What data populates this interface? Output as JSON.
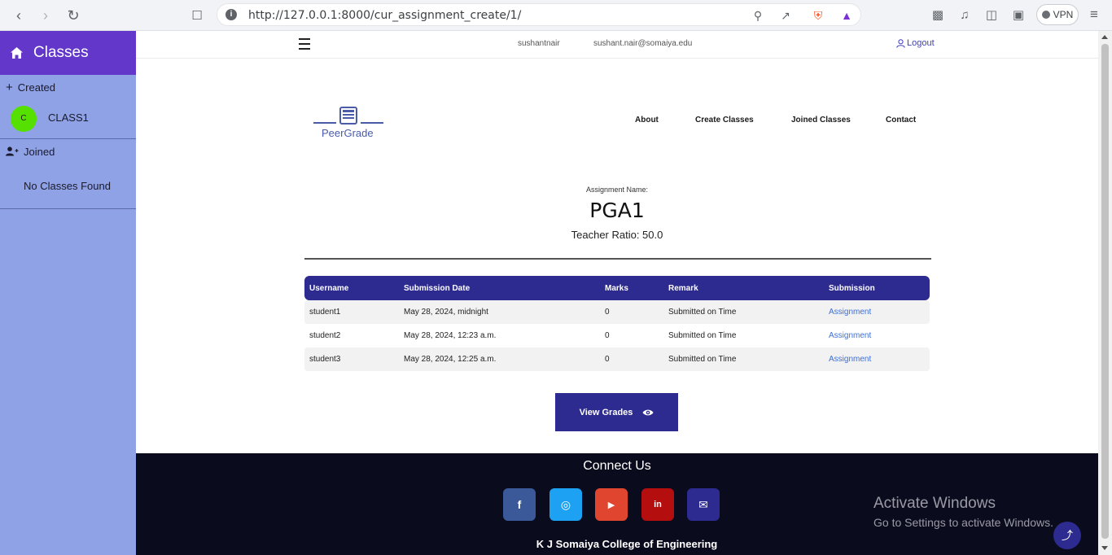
{
  "browser": {
    "url": "http://127.0.0.1:8000/cur_assignment_create/1/",
    "vpn_label": "VPN"
  },
  "sidebar": {
    "title": "Classes",
    "created_label": "Created",
    "created_classes": [
      {
        "avatar": "C",
        "name": "CLASS1"
      }
    ],
    "joined_label": "Joined",
    "joined_empty": "No Classes Found"
  },
  "topbar": {
    "username": "sushantnair",
    "email": "sushant.nair@somaiya.edu",
    "logout": "Logout"
  },
  "brand": {
    "name": "PeerGrade"
  },
  "nav": {
    "about": "About",
    "create_classes": "Create Classes",
    "joined_classes": "Joined Classes",
    "contact": "Contact"
  },
  "assignment": {
    "label": "Assignment Name:",
    "name": "PGA1",
    "ratio": "Teacher Ratio: 50.0"
  },
  "table": {
    "headers": [
      "Username",
      "Submission Date",
      "Marks",
      "Remark",
      "Submission"
    ],
    "rows": [
      [
        "student1",
        "May 28, 2024, midnight",
        "0",
        "Submitted on Time",
        "Assignment"
      ],
      [
        "student2",
        "May 28, 2024, 12:23 a.m.",
        "0",
        "Submitted on Time",
        "Assignment"
      ],
      [
        "student3",
        "May 28, 2024, 12:25 a.m.",
        "0",
        "Submitted on Time",
        "Assignment"
      ]
    ]
  },
  "actions": {
    "view_grades": "View Grades"
  },
  "footer": {
    "connect": "Connect Us",
    "college": "K J Somaiya College of Engineering",
    "social": [
      {
        "name": "facebook-icon",
        "glyph": "f",
        "color": "#3b5998"
      },
      {
        "name": "instagram-icon",
        "glyph": "◎",
        "color": "#1da1f2"
      },
      {
        "name": "youtube-icon",
        "glyph": "▶",
        "color": "#e0452f"
      },
      {
        "name": "linkedin-icon",
        "glyph": "in",
        "color": "#b50e0e"
      },
      {
        "name": "email-icon",
        "glyph": "✉",
        "color": "#2d2b8f"
      }
    ]
  },
  "watermark": {
    "line1": "Activate Windows",
    "line2": "Go to Settings to activate Windows."
  },
  "colors": {
    "sidebar_bg": "#8fa2e5",
    "sidebar_head": "#6337c9",
    "accent": "#2d2b8f",
    "footer_bg": "#0b0b1e"
  }
}
